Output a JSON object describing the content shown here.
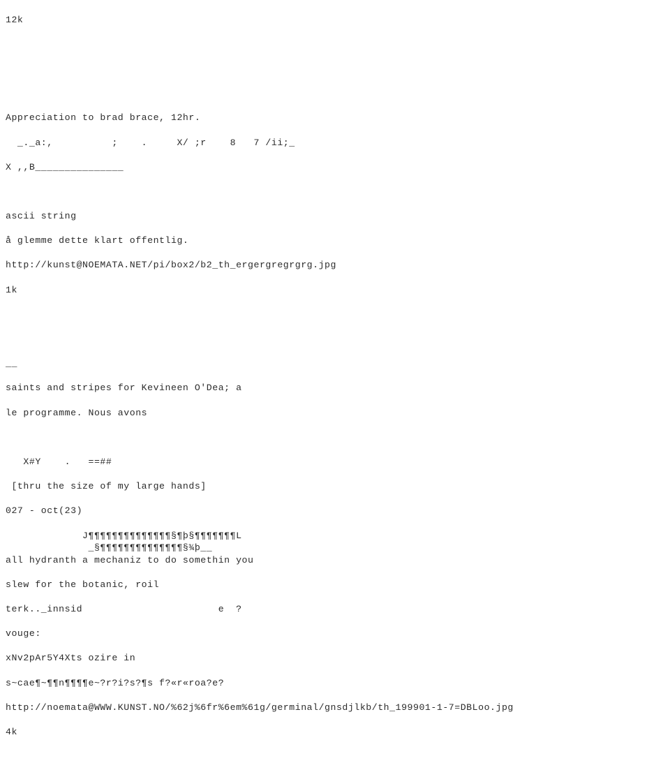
{
  "document": {
    "kind": "plain-text-dump",
    "background_color": "#ffffff",
    "text_color": "#2b2b2b",
    "font_kind": "monospace",
    "font_size_px": 13,
    "line_height_px": 17.6,
    "blocks": {
      "size_top": "12k",
      "blank_1": "",
      "blank_2": "",
      "appreciation": "Appreciation to brad brace, 12hr.",
      "symbols_row": "  _._a:,          ;    .     X/ ;r    8   7 /ii;_",
      "x_b_row": "X ,,B_______________",
      "blank_3": "",
      "ascii_string": "ascii string",
      "norwegian_line": "å glemme dette klart offentlig.",
      "url_1": "http://kunst@NOEMATA.NET/pi/box2/b2_th_ergergregrgrg.jpg",
      "size_1k": "1k",
      "blank_4": "",
      "blank_5": "",
      "underscore_sep": "__",
      "saints_line": "saints and stripes for Kevineen O'Dea; a",
      "programme_line": "le programme. Nous avons",
      "blank_6": "",
      "xy_row": "   X#Y    .   ==##",
      "thru_line": " [thru the size of my large hands]",
      "oct_line": "027 - oct(23)",
      "pilcrow_row_1": "             J¶¶¶¶¶¶¶¶¶¶¶¶¶¶§¶þ§¶¶¶¶¶¶¶L",
      "pilcrow_row_2": "              _§¶¶¶¶¶¶¶¶¶¶¶¶¶¶§¾þ__",
      "hydranth_line": "all hydranth a mechaniz to do somethin you",
      "slew_line": "slew for the botanic, roil",
      "terk_line": "terk.._innsid                       e  ?",
      "vouge_line": "vouge:",
      "xnv_line": "xNv2pAr5Y4Xts ozire in",
      "scae_line": "s~cae¶~¶¶n¶¶¶¶e~?r?i?s?¶s f?«r«roa?e?",
      "url_2": "http://noemata@WWW.KUNST.NO/%62j%6fr%6em%61g/germinal/gnsdjlkb/th_199901-1-7=DBLoo.jpg",
      "size_4k": "4k"
    }
  }
}
